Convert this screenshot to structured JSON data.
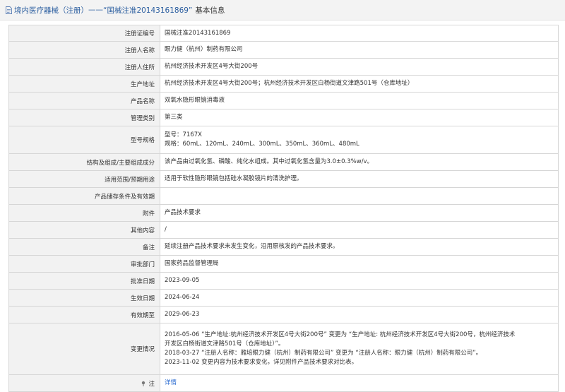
{
  "header": {
    "prefix": "境内医疗器械（注册）",
    "separator": "——",
    "reg_title": "“国械注准20143161869”",
    "suffix": "基本信息"
  },
  "fields": [
    {
      "label": "注册证编号",
      "lines": [
        "国械注准20143161869"
      ]
    },
    {
      "label": "注册人名称",
      "lines": [
        "眼力健（杭州）制药有限公司"
      ]
    },
    {
      "label": "注册人住所",
      "lines": [
        "杭州经济技术开发区4号大街200号"
      ]
    },
    {
      "label": "生产地址",
      "lines": [
        "杭州经济技术开发区4号大街200号；杭州经济技术开发区白杨街道文津路501号（仓库地址）"
      ]
    },
    {
      "label": "产品名称",
      "lines": [
        "双氧水隐形眼镜消毒液"
      ]
    },
    {
      "label": "管理类别",
      "lines": [
        "第三类"
      ]
    },
    {
      "label": "型号规格",
      "lines": [
        "型号：7167X",
        "规格：60mL、120mL、240mL、300mL、350mL、360mL、480mL"
      ]
    },
    {
      "label": "结构及组成/主要组成成分",
      "lines": [
        "该产品由过氧化氢、磷酸、纯化水组成。其中过氧化氢含量为3.0±0.3%w/v。"
      ]
    },
    {
      "label": "适用范围/预期用途",
      "lines": [
        "适用于软性隐形眼镜包括硅水凝胶镜片的清洗护理。"
      ]
    },
    {
      "label": "产品储存条件及有效期",
      "lines": [
        ""
      ]
    },
    {
      "label": "附件",
      "lines": [
        "产品技术要求"
      ]
    },
    {
      "label": "其他内容",
      "lines": [
        "/"
      ]
    },
    {
      "label": "备注",
      "lines": [
        "延续注册产品技术要求未发生变化，沿用原核发的产品技术要求。"
      ]
    },
    {
      "label": "审批部门",
      "lines": [
        "国家药品监督管理局"
      ]
    },
    {
      "label": "批准日期",
      "lines": [
        "2023-09-05"
      ]
    },
    {
      "label": "生效日期",
      "lines": [
        "2024-06-24"
      ]
    },
    {
      "label": "有效期至",
      "lines": [
        "2029-06-23"
      ]
    },
    {
      "label": "变更情况",
      "lines": [
        "2016-05-06 “生产地址:杭州经济技术开发区4号大街200号” 变更为 “生产地址: 杭州经济技术开发区4号大街200号，杭州经济技术",
        "开发区白杨街道文津路501号（仓库地址）”。",
        "2018-03-27 “注册人名称：雅培眼力健（杭州）制药有限公司” 变更为 “注册人名称：眼力健（杭州）制药有限公司”。",
        "2023-11-02 变更内容为技术要求变化，详见附件产品技术要求对比表。"
      ]
    }
  ],
  "footer_row": {
    "label": "注",
    "link": "详情"
  },
  "colors": {
    "accent": "#2a5d9f",
    "link": "#2a6bd1",
    "label_bg": "#f2f2f2",
    "border": "#d6d6d6"
  },
  "icons": {
    "header": "document-icon",
    "footer": "pin-icon"
  }
}
